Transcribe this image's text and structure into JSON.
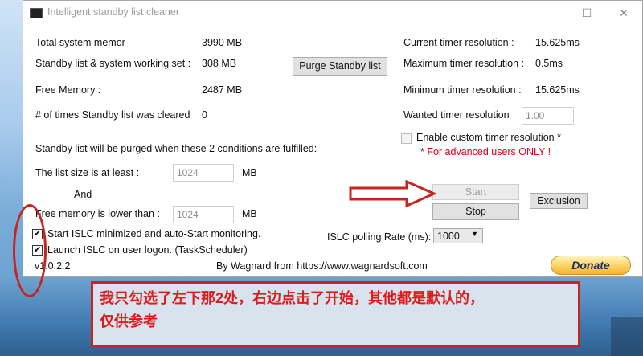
{
  "window": {
    "title": "Intelligent standby list cleaner",
    "controls": {
      "minimize": "—",
      "maximize": "☐",
      "close": "✕"
    }
  },
  "memory": {
    "total_label": "Total system memor",
    "total_value": "3990 MB",
    "standby_label": "Standby list & system working set :",
    "standby_value": "308 MB",
    "free_label": "Free Memory :",
    "free_value": "2487 MB",
    "cleared_label": "# of times Standby list was cleared",
    "cleared_value": "0"
  },
  "buttons": {
    "purge": "Purge Standby list",
    "start": "Start",
    "stop": "Stop",
    "exclusion": "Exclusion",
    "donate": "Donate"
  },
  "timer": {
    "current_label": "Current timer resolution :",
    "current_value": "15.625ms",
    "max_label": "Maximum timer resolution :",
    "max_value": "0.5ms",
    "min_label": "Minimum timer resolution :",
    "min_value": "15.625ms",
    "wanted_label": "Wanted timer resolution",
    "wanted_value": "1.00",
    "custom_label": "Enable custom timer resolution *",
    "advanced_note": "* For advanced users ONLY !"
  },
  "conditions": {
    "heading": "Standby list will be purged when these 2 conditions are fulfilled:",
    "list_size_label": "The list size is at least :",
    "list_size_value": "1024",
    "and_label": "And",
    "free_lower_label": "Free memory is lower than :",
    "free_lower_value": "1024",
    "unit": "MB"
  },
  "options": {
    "start_minimized": "Start ISLC minimized and auto-Start monitoring.",
    "start_minimized_checked": true,
    "launch_logon": "Launch ISLC on user logon. (TaskScheduler)",
    "launch_logon_checked": true
  },
  "polling": {
    "label": "ISLC polling Rate (ms):",
    "value": "1000"
  },
  "footer": {
    "version": "v1.0.2.2",
    "credit": "By Wagnard from https://www.wagnardsoft.com"
  },
  "annotation": {
    "line1": "我只勾选了左下那2处，右边点击了开始，其他都是默认的，",
    "line2": "仅供参考",
    "color": "#e01a1a"
  }
}
